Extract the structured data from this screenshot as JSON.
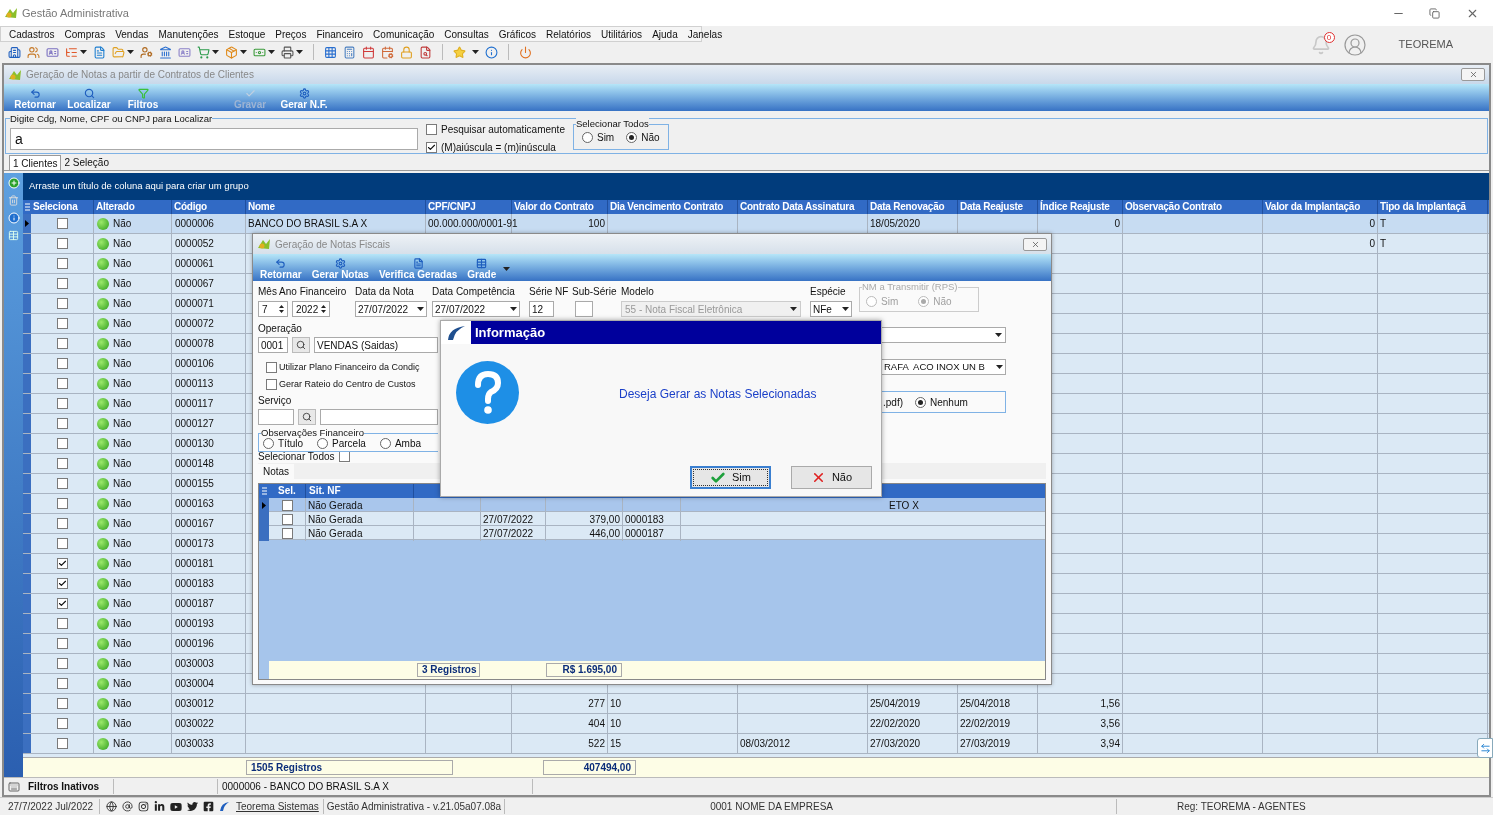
{
  "app": {
    "title": "Gestão Administrativa",
    "notifications": "0",
    "user": "TEOREMA"
  },
  "menu": [
    "Cadastros",
    "Compras",
    "Vendas",
    "Manutenções",
    "Estoque",
    "Preços",
    "Financeiro",
    "Comunicação",
    "Consultas",
    "Gráficos",
    "Relatórios",
    "Utilitários",
    "Ajuda",
    "Janelas"
  ],
  "window": {
    "title": "Geração de Notas a partir de Contratos de Clientes",
    "toolbar": [
      {
        "label": "Retornar",
        "disabled": false
      },
      {
        "label": "Localizar",
        "disabled": false
      },
      {
        "label": "Filtros",
        "disabled": false
      },
      {
        "label": "Gravar",
        "disabled": true
      },
      {
        "label": "Gerar N.F.",
        "disabled": false
      }
    ],
    "search": {
      "legend": "Digite Cdg, Nome, CPF ou CNPJ para Localizar",
      "value": "a"
    },
    "options": [
      {
        "label": "Pesquisar automaticamente",
        "checked": false
      },
      {
        "label": "(M)aiúscula = (m)inúscula",
        "checked": true
      }
    ],
    "select_all": {
      "legend": "Selecionar Todos",
      "options": [
        {
          "label": "Sim",
          "selected": false
        },
        {
          "label": "Não",
          "selected": true
        }
      ]
    },
    "tabs": [
      {
        "label": "1 Clientes",
        "selected": true
      },
      {
        "label": "2 Seleção",
        "selected": false
      }
    ],
    "group_hint": "Arraste um título de coluna aqui para criar um grupo",
    "table": {
      "columns": [
        "Seleciona",
        "Alterado",
        "Código",
        "Nome",
        "CPF/CNPJ",
        "Valor do Contrato",
        "Dia Vencimento Contrato",
        "Contrato Data Assinatura",
        "Data Renovação",
        "Data Reajuste",
        "Índice Reajuste",
        "Observação Contrato",
        "Valor da Implantação",
        "Tipo da Implantaçã"
      ],
      "rows": [
        {
          "selected": true,
          "checked": false,
          "altered": "Não",
          "code": "0000006",
          "name": "BANCO DO BRASIL S.A X",
          "cpf": "00.000.000/0001-91",
          "contract_value": "100",
          "renewal_date": "18/05/2020",
          "adjustment_index": "0",
          "implantation_value": "0",
          "implantation_type": "T"
        },
        {
          "selected": false,
          "checked": false,
          "altered": "Não",
          "code": "0000052",
          "implantation_value": "0",
          "implantation_type": "T"
        },
        {
          "selected": false,
          "checked": false,
          "altered": "Não",
          "code": "0000061"
        },
        {
          "selected": false,
          "checked": false,
          "altered": "Não",
          "code": "0000067"
        },
        {
          "selected": false,
          "checked": false,
          "altered": "Não",
          "code": "0000071"
        },
        {
          "selected": false,
          "checked": false,
          "altered": "Não",
          "code": "0000072"
        },
        {
          "selected": false,
          "checked": false,
          "altered": "Não",
          "code": "0000078"
        },
        {
          "selected": false,
          "checked": false,
          "altered": "Não",
          "code": "0000106"
        },
        {
          "selected": false,
          "checked": false,
          "altered": "Não",
          "code": "0000113"
        },
        {
          "selected": false,
          "checked": false,
          "altered": "Não",
          "code": "0000117"
        },
        {
          "selected": false,
          "checked": false,
          "altered": "Não",
          "code": "0000127"
        },
        {
          "selected": false,
          "checked": false,
          "altered": "Não",
          "code": "0000130"
        },
        {
          "selected": false,
          "checked": false,
          "altered": "Não",
          "code": "0000148"
        },
        {
          "selected": false,
          "checked": false,
          "altered": "Não",
          "code": "0000155"
        },
        {
          "selected": false,
          "checked": false,
          "altered": "Não",
          "code": "0000163"
        },
        {
          "selected": false,
          "checked": false,
          "altered": "Não",
          "code": "0000167"
        },
        {
          "selected": false,
          "checked": false,
          "altered": "Não",
          "code": "0000173"
        },
        {
          "selected": false,
          "checked": true,
          "altered": "Não",
          "code": "0000181"
        },
        {
          "selected": false,
          "checked": true,
          "altered": "Não",
          "code": "0000183"
        },
        {
          "selected": false,
          "checked": true,
          "altered": "Não",
          "code": "0000187"
        },
        {
          "selected": false,
          "checked": false,
          "altered": "Não",
          "code": "0000193"
        },
        {
          "selected": false,
          "checked": false,
          "altered": "Não",
          "code": "0000196"
        },
        {
          "selected": false,
          "checked": false,
          "altered": "Não",
          "code": "0030003"
        },
        {
          "selected": false,
          "checked": false,
          "altered": "Não",
          "code": "0030004"
        },
        {
          "selected": false,
          "checked": false,
          "altered": "Não",
          "code": "0030012",
          "contract_value": "277",
          "due_day": "10",
          "renewal_date": "25/04/2019",
          "adjustment_date": "25/04/2018",
          "adjustment_index": "1,56"
        },
        {
          "selected": false,
          "checked": false,
          "altered": "Não",
          "code": "0030022",
          "contract_value": "404",
          "due_day": "10",
          "renewal_date": "22/02/2020",
          "adjustment_date": "22/02/2019",
          "adjustment_index": "3,56"
        },
        {
          "selected": false,
          "checked": false,
          "altered": "Não",
          "code": "0030033",
          "contract_value": "522",
          "due_day": "15",
          "signing_date": "08/03/2012",
          "renewal_date": "27/03/2020",
          "adjustment_date": "27/03/2019",
          "adjustment_index": "3,94"
        }
      ],
      "footer": {
        "count": "1505 Registros",
        "total": "407494,00"
      }
    },
    "filter_status": "Filtros Inativos",
    "current_record": "0000006 - BANCO DO BRASIL S.A X"
  },
  "dialog": {
    "title": "Geração de Notas Fiscais",
    "toolbar": [
      "Retornar",
      "Gerar Notas",
      "Verifica Geradas",
      "Grade"
    ],
    "fields": {
      "financial_label": "Mês Ano Financeiro",
      "month": "7",
      "year": "2022",
      "note_date_label": "Data da Nota",
      "note_date": "27/07/2022",
      "competence_label": "Data Competência",
      "competence": "27/07/2022",
      "series_label": "Série NF",
      "series": "12",
      "subseries_label": "Sub-Série",
      "model_label": "Modelo",
      "model": "55 - Nota Fiscal Eletrônica",
      "species_label": "Espécie",
      "species": "NFe"
    },
    "rps": {
      "legend": "NM a Transmitir (RPS)",
      "disabled": true,
      "options": [
        {
          "label": "Sim",
          "selected": false
        },
        {
          "label": "Não",
          "selected": true
        }
      ]
    },
    "operation": {
      "label": "Operação",
      "code": "0001",
      "name": "VENDAS (Saidas)"
    },
    "checks": [
      {
        "label": "Utilizar Plano Financeiro da Condiç",
        "checked": false
      },
      {
        "label": "Gerar Rateio do Centro de Custos",
        "checked": false
      }
    ],
    "service_label": "Serviço",
    "observations": {
      "legend": "Observações Financeiro",
      "options": [
        {
          "label": "Título",
          "selected": false
        },
        {
          "label": "Parcela",
          "selected": false
        },
        {
          "label": "Amba",
          "selected": false
        }
      ]
    },
    "product": "RAFA  ACO INOX UN B",
    "format": {
      "text": ".pdf)",
      "option": {
        "label": "Nenhum",
        "selected": true
      }
    },
    "select_all": {
      "label": "Selecionar Todos",
      "checked": false
    },
    "tab": "Notas",
    "table": {
      "columns": [
        "Sel.",
        "Sit. NF"
      ],
      "rows": [
        {
          "selected": true,
          "checked": false,
          "status": "Não Gerada",
          "description": "ETO X"
        },
        {
          "selected": false,
          "checked": false,
          "status": "Não Gerada",
          "date": "27/07/2022",
          "value": "379,00",
          "code": "0000183"
        },
        {
          "selected": false,
          "checked": false,
          "status": "Não Gerada",
          "date": "27/07/2022",
          "value": "446,00",
          "code": "0000187"
        }
      ],
      "footer": {
        "count": "3 Registros",
        "total": "R$ 1.695,00"
      }
    }
  },
  "message": {
    "title": "Informação",
    "text": "Deseja Gerar as Notas Selecionadas",
    "buttons": [
      {
        "label": "Sim",
        "kind": "confirm",
        "focused": true
      },
      {
        "label": "Não",
        "kind": "cancel",
        "focused": false
      }
    ]
  },
  "status_bar": {
    "date": "27/7/2022 Jul/2022",
    "link": "Teorema Sistemas",
    "version": "Gestão Administrativa - v.21.05a07.08a",
    "company": "0001 NOME DA EMPRESA",
    "registration": "Reg: TEOREMA - AGENTES"
  }
}
